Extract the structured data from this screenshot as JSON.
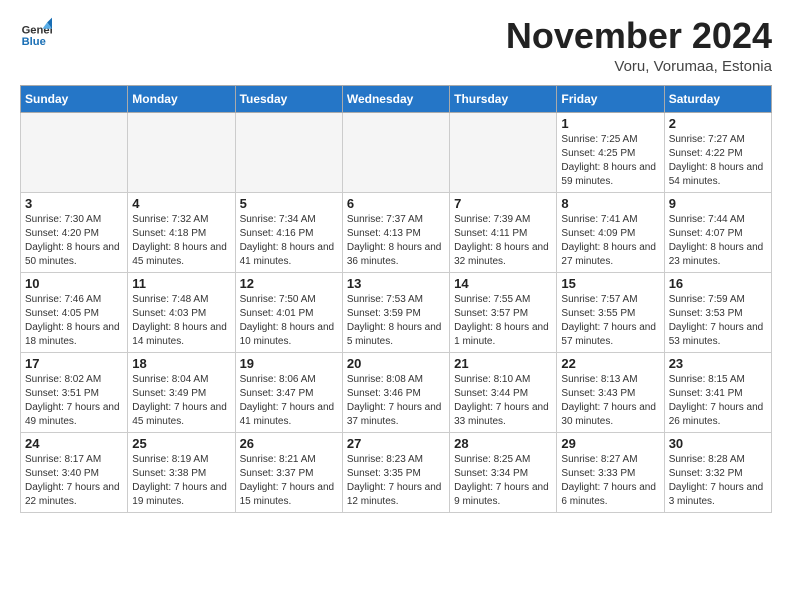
{
  "header": {
    "logo_general": "General",
    "logo_blue": "Blue",
    "month_title": "November 2024",
    "subtitle": "Voru, Vorumaa, Estonia"
  },
  "weekdays": [
    "Sunday",
    "Monday",
    "Tuesday",
    "Wednesday",
    "Thursday",
    "Friday",
    "Saturday"
  ],
  "weeks": [
    [
      {
        "day": "",
        "info": ""
      },
      {
        "day": "",
        "info": ""
      },
      {
        "day": "",
        "info": ""
      },
      {
        "day": "",
        "info": ""
      },
      {
        "day": "",
        "info": ""
      },
      {
        "day": "1",
        "info": "Sunrise: 7:25 AM\nSunset: 4:25 PM\nDaylight: 8 hours and 59 minutes."
      },
      {
        "day": "2",
        "info": "Sunrise: 7:27 AM\nSunset: 4:22 PM\nDaylight: 8 hours and 54 minutes."
      }
    ],
    [
      {
        "day": "3",
        "info": "Sunrise: 7:30 AM\nSunset: 4:20 PM\nDaylight: 8 hours and 50 minutes."
      },
      {
        "day": "4",
        "info": "Sunrise: 7:32 AM\nSunset: 4:18 PM\nDaylight: 8 hours and 45 minutes."
      },
      {
        "day": "5",
        "info": "Sunrise: 7:34 AM\nSunset: 4:16 PM\nDaylight: 8 hours and 41 minutes."
      },
      {
        "day": "6",
        "info": "Sunrise: 7:37 AM\nSunset: 4:13 PM\nDaylight: 8 hours and 36 minutes."
      },
      {
        "day": "7",
        "info": "Sunrise: 7:39 AM\nSunset: 4:11 PM\nDaylight: 8 hours and 32 minutes."
      },
      {
        "day": "8",
        "info": "Sunrise: 7:41 AM\nSunset: 4:09 PM\nDaylight: 8 hours and 27 minutes."
      },
      {
        "day": "9",
        "info": "Sunrise: 7:44 AM\nSunset: 4:07 PM\nDaylight: 8 hours and 23 minutes."
      }
    ],
    [
      {
        "day": "10",
        "info": "Sunrise: 7:46 AM\nSunset: 4:05 PM\nDaylight: 8 hours and 18 minutes."
      },
      {
        "day": "11",
        "info": "Sunrise: 7:48 AM\nSunset: 4:03 PM\nDaylight: 8 hours and 14 minutes."
      },
      {
        "day": "12",
        "info": "Sunrise: 7:50 AM\nSunset: 4:01 PM\nDaylight: 8 hours and 10 minutes."
      },
      {
        "day": "13",
        "info": "Sunrise: 7:53 AM\nSunset: 3:59 PM\nDaylight: 8 hours and 5 minutes."
      },
      {
        "day": "14",
        "info": "Sunrise: 7:55 AM\nSunset: 3:57 PM\nDaylight: 8 hours and 1 minute."
      },
      {
        "day": "15",
        "info": "Sunrise: 7:57 AM\nSunset: 3:55 PM\nDaylight: 7 hours and 57 minutes."
      },
      {
        "day": "16",
        "info": "Sunrise: 7:59 AM\nSunset: 3:53 PM\nDaylight: 7 hours and 53 minutes."
      }
    ],
    [
      {
        "day": "17",
        "info": "Sunrise: 8:02 AM\nSunset: 3:51 PM\nDaylight: 7 hours and 49 minutes."
      },
      {
        "day": "18",
        "info": "Sunrise: 8:04 AM\nSunset: 3:49 PM\nDaylight: 7 hours and 45 minutes."
      },
      {
        "day": "19",
        "info": "Sunrise: 8:06 AM\nSunset: 3:47 PM\nDaylight: 7 hours and 41 minutes."
      },
      {
        "day": "20",
        "info": "Sunrise: 8:08 AM\nSunset: 3:46 PM\nDaylight: 7 hours and 37 minutes."
      },
      {
        "day": "21",
        "info": "Sunrise: 8:10 AM\nSunset: 3:44 PM\nDaylight: 7 hours and 33 minutes."
      },
      {
        "day": "22",
        "info": "Sunrise: 8:13 AM\nSunset: 3:43 PM\nDaylight: 7 hours and 30 minutes."
      },
      {
        "day": "23",
        "info": "Sunrise: 8:15 AM\nSunset: 3:41 PM\nDaylight: 7 hours and 26 minutes."
      }
    ],
    [
      {
        "day": "24",
        "info": "Sunrise: 8:17 AM\nSunset: 3:40 PM\nDaylight: 7 hours and 22 minutes."
      },
      {
        "day": "25",
        "info": "Sunrise: 8:19 AM\nSunset: 3:38 PM\nDaylight: 7 hours and 19 minutes."
      },
      {
        "day": "26",
        "info": "Sunrise: 8:21 AM\nSunset: 3:37 PM\nDaylight: 7 hours and 15 minutes."
      },
      {
        "day": "27",
        "info": "Sunrise: 8:23 AM\nSunset: 3:35 PM\nDaylight: 7 hours and 12 minutes."
      },
      {
        "day": "28",
        "info": "Sunrise: 8:25 AM\nSunset: 3:34 PM\nDaylight: 7 hours and 9 minutes."
      },
      {
        "day": "29",
        "info": "Sunrise: 8:27 AM\nSunset: 3:33 PM\nDaylight: 7 hours and 6 minutes."
      },
      {
        "day": "30",
        "info": "Sunrise: 8:28 AM\nSunset: 3:32 PM\nDaylight: 7 hours and 3 minutes."
      }
    ]
  ]
}
